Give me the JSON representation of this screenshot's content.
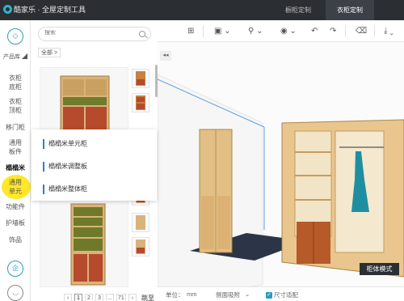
{
  "app": {
    "title": "酷家乐 · 全屋定制工具",
    "tabs": [
      {
        "label": "橱柜定制",
        "active": false
      },
      {
        "label": "衣柜定制",
        "active": true
      }
    ],
    "colors": {
      "titlebar": "#2b2e33",
      "accent": "#2a9cc0",
      "highlight": "#ffe400"
    }
  },
  "rail": {
    "top_icon": "cube-icon",
    "section_label": "产品库",
    "items": [
      {
        "label": "衣柜\n底柜"
      },
      {
        "label": "衣柜\n顶柜"
      },
      {
        "label": "移门柜"
      },
      {
        "label": "通用\n板件"
      },
      {
        "label": "榻榻米"
      },
      {
        "label": "通用\n单元"
      },
      {
        "label": "功能件"
      },
      {
        "label": "护墙板"
      },
      {
        "label": "饰品"
      }
    ],
    "bottom_icon_1": "企",
    "bottom_icon_2": "user-icon"
  },
  "panel": {
    "search_placeholder": "搜索",
    "breadcrumb": "全部 >",
    "pager": {
      "pages": [
        "‹",
        "1",
        "2",
        "3",
        "...",
        "71",
        "›"
      ],
      "current": "1",
      "jump_label": "跳至"
    }
  },
  "popup": {
    "items": [
      "榻榻米单元柜",
      "榻榻米调整板",
      "榻榻米整体柜"
    ]
  },
  "toolbar": {
    "icons": [
      "layout-icon",
      "view-icon",
      "tool-icon",
      "eye-icon",
      "undo-icon",
      "redo-icon",
      "eraser-icon"
    ]
  },
  "viewport": {
    "collapse_label": "◂◂",
    "mode_button": "柜体模式"
  },
  "statusbar": {
    "unit_label": "单位：",
    "unit_value": "mm",
    "side_label": "侧面吸附",
    "side_caret": "⌄",
    "fit_label": "尺寸适配"
  }
}
